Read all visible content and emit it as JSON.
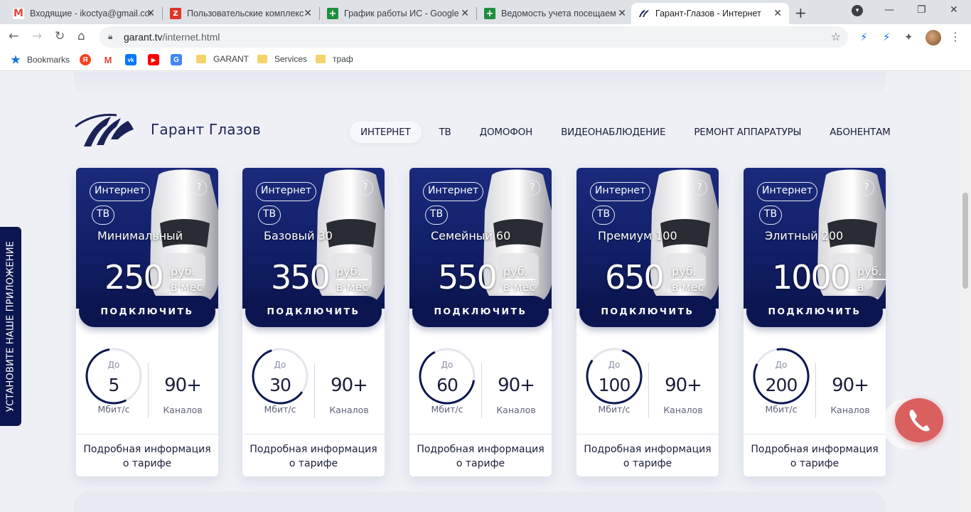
{
  "browser": {
    "tabs": [
      {
        "title": "Входящие - ikoctya@gmail.com",
        "favicon": "gmail-icon",
        "active": false
      },
      {
        "title": "Пользовательские комплекс",
        "favicon": "zoho-icon",
        "active": false
      },
      {
        "title": "График работы ИС - Google",
        "favicon": "sheets-icon",
        "active": false
      },
      {
        "title": "Ведомость учета посещаем",
        "favicon": "sheets-icon",
        "active": false
      },
      {
        "title": "Гарант-Глазов - Интернет",
        "favicon": "garant-icon",
        "active": true
      }
    ],
    "url_host": "garant.tv",
    "url_path": "/internet.html",
    "bookmarks": [
      {
        "label": "Bookmarks",
        "icon": "star-icon"
      },
      {
        "label": "",
        "icon": "yandex-icon"
      },
      {
        "label": "",
        "icon": "gmail-icon"
      },
      {
        "label": "",
        "icon": "vk-icon"
      },
      {
        "label": "",
        "icon": "youtube-icon"
      },
      {
        "label": "",
        "icon": "translate-icon"
      },
      {
        "label": "GARANT",
        "icon": "folder-icon"
      },
      {
        "label": "Services",
        "icon": "folder-icon"
      },
      {
        "label": "траф",
        "icon": "folder-icon"
      }
    ]
  },
  "site": {
    "brand": "Гарант Глазов",
    "nav": [
      "ИНТЕРНЕТ",
      "ТВ",
      "ДОМОФОН",
      "ВИДЕОНАБЛЮДЕНИЕ",
      "РЕМОНТ АППАРАТУРЫ",
      "АБОНЕНТАМ"
    ],
    "side_banner": "УСТАНОВИТЕ НАШЕ ПРИЛОЖЕНИЕ",
    "common": {
      "tag_internet": "Интернет",
      "tag_tv": "ТВ",
      "help": "?",
      "price_unit_1": "руб.",
      "price_unit_2": "в мес",
      "connect": "ПОДКЛЮЧИТЬ",
      "speed_prefix": "До",
      "speed_unit": "Мбит/с",
      "channels_unit": "Каналов",
      "details": "Подробная информация о тарифе"
    },
    "plans": [
      {
        "name": "Минимальный",
        "price": "250",
        "speed": "5",
        "speed_fraction": 0.55,
        "channels": "90+"
      },
      {
        "name": "Базовый 30",
        "price": "350",
        "speed": "30",
        "speed_fraction": 0.6,
        "channels": "90+"
      },
      {
        "name": "Семейный 60",
        "price": "550",
        "speed": "60",
        "speed_fraction": 0.65,
        "channels": "90+"
      },
      {
        "name": "Премиум 100",
        "price": "650",
        "speed": "100",
        "speed_fraction": 0.8,
        "channels": "90+"
      },
      {
        "name": "Элитный 200",
        "price": "1000",
        "speed": "200",
        "speed_fraction": 0.85,
        "channels": "90+"
      }
    ]
  },
  "colors": {
    "brand_navy": "#0b1650",
    "call_red": "#d9605f"
  }
}
